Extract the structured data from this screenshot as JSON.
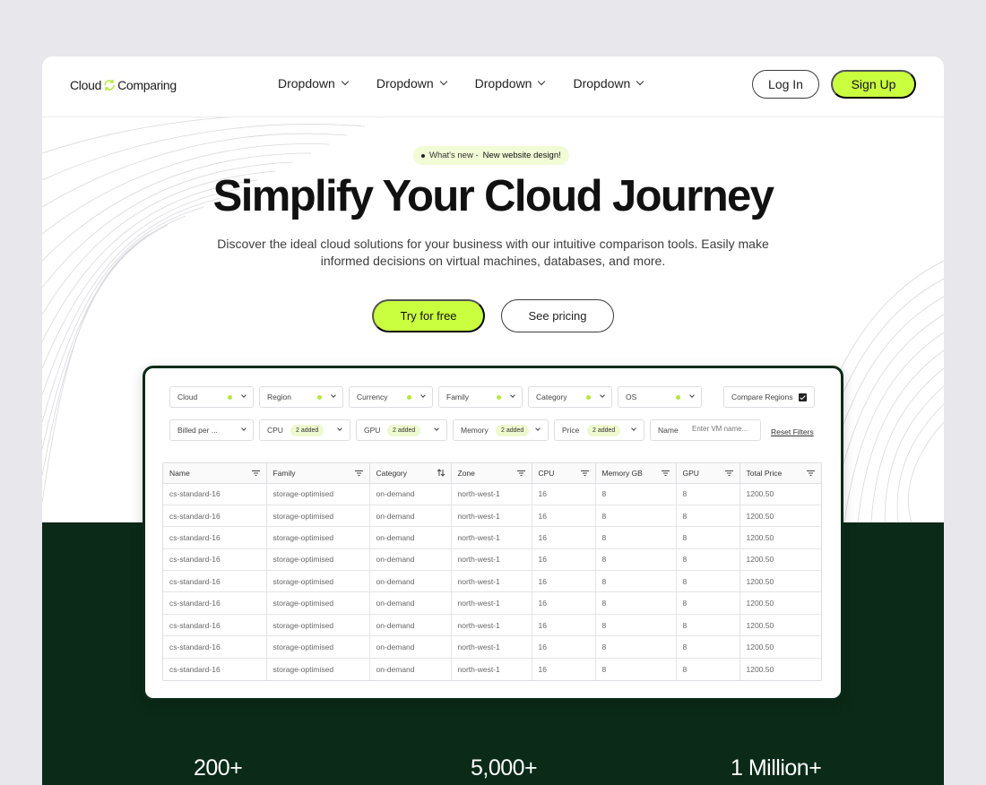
{
  "nav": {
    "logo_left": "Cloud",
    "logo_right": "Comparing",
    "menu": [
      "Dropdown",
      "Dropdown",
      "Dropdown",
      "Dropdown"
    ],
    "login": "Log In",
    "signup": "Sign Up"
  },
  "hero": {
    "badge_prefix": "What's new -",
    "badge_highlight": "New website design!",
    "title": "Simplify Your Cloud Journey",
    "subtitle": "Discover the ideal cloud solutions for your business with our intuitive comparison tools. Easily make informed decisions on virtual machines, databases, and more.",
    "cta_primary": "Try for free",
    "cta_secondary": "See pricing"
  },
  "filters": {
    "row1": [
      "Cloud",
      "Region",
      "Currency",
      "Family",
      "Category",
      "OS"
    ],
    "compare_regions": "Compare Regions",
    "billed": "Billed per ...",
    "row2": [
      {
        "label": "CPU",
        "tag": "2 added"
      },
      {
        "label": "GPU",
        "tag": "2 added"
      },
      {
        "label": "Memory",
        "tag": "2 added"
      },
      {
        "label": "Price",
        "tag": "2 added"
      }
    ],
    "name_label": "Name",
    "name_placeholder": "Enter VM name...",
    "reset": "Reset Filters"
  },
  "table": {
    "columns": [
      "Name",
      "Family",
      "Category",
      "Zone",
      "CPU",
      "Memory GB",
      "GPU",
      "Total Price"
    ],
    "rows": [
      [
        "cs-standard-16",
        "storage-optimised",
        "on-demand",
        "north-west-1",
        "16",
        "8",
        "8",
        "1200.50"
      ],
      [
        "cs-standard-16",
        "storage-optimised",
        "on-demand",
        "north-west-1",
        "16",
        "8",
        "8",
        "1200.50"
      ],
      [
        "cs-standard-16",
        "storage-optimised",
        "on-demand",
        "north-west-1",
        "16",
        "8",
        "8",
        "1200.50"
      ],
      [
        "cs-standard-16",
        "storage-optimised",
        "on-demand",
        "north-west-1",
        "16",
        "8",
        "8",
        "1200.50"
      ],
      [
        "cs-standard-16",
        "storage-optimised",
        "on-demand",
        "north-west-1",
        "16",
        "8",
        "8",
        "1200.50"
      ],
      [
        "cs-standard-16",
        "storage-optimised",
        "on-demand",
        "north-west-1",
        "16",
        "8",
        "8",
        "1200.50"
      ],
      [
        "cs-standard-16",
        "storage-optimised",
        "on-demand",
        "north-west-1",
        "16",
        "8",
        "8",
        "1200.50"
      ],
      [
        "cs-standard-16",
        "storage-optimised",
        "on-demand",
        "north-west-1",
        "16",
        "8",
        "8",
        "1200.50"
      ],
      [
        "cs-standard-16",
        "storage-optimised",
        "on-demand",
        "north-west-1",
        "16",
        "8",
        "8",
        "1200.50"
      ]
    ]
  },
  "stats": [
    "200+",
    "5,000+",
    "1 Million+"
  ],
  "colors": {
    "accent": "#caff3f",
    "dark": "#0b2a18",
    "background": "#e7e7ec"
  },
  "icons": {
    "logo": "sync-arrows-icon",
    "dropdown": "chevron-down-icon",
    "filter": "filter-lines-icon",
    "sort": "sort-arrows-icon"
  }
}
